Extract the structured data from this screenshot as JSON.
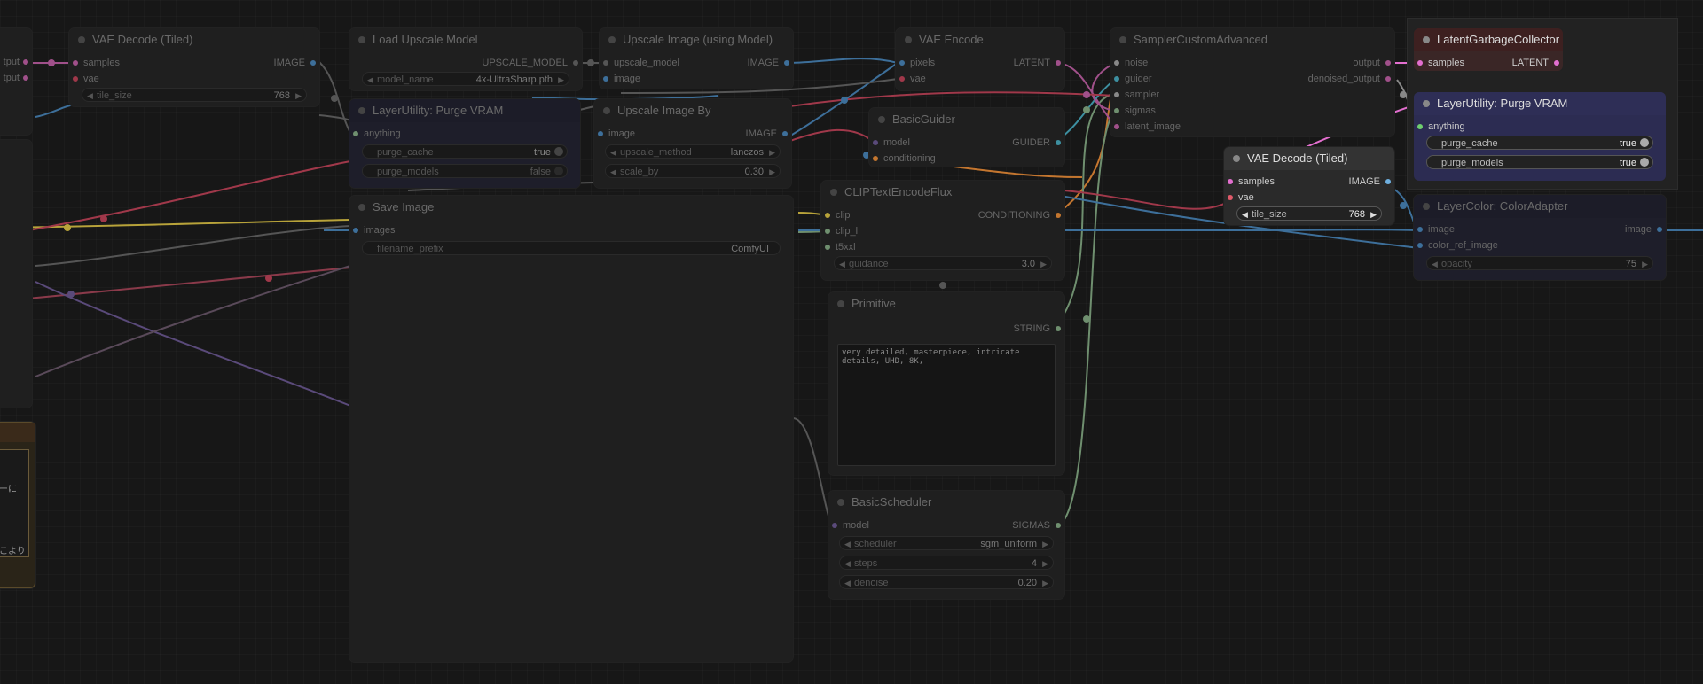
{
  "nodes": {
    "vae_decode_tiled_left": {
      "title": "VAE Decode (Tiled)",
      "inputs": [
        "samples",
        "vae"
      ],
      "output": "IMAGE",
      "tile_size": {
        "label": "tile_size",
        "value": "768"
      }
    },
    "left_cut": {
      "outputs": [
        "tput",
        "tput"
      ],
      "text_fragments": [
        "ーに",
        "こより"
      ]
    },
    "load_upscale_model": {
      "title": "Load Upscale Model",
      "output": "UPSCALE_MODEL",
      "model_name": {
        "label": "model_name",
        "value": "4x-UltraSharp.pth"
      }
    },
    "upscale_image_using_model": {
      "title": "Upscale Image (using Model)",
      "inputs": [
        "upscale_model",
        "image"
      ],
      "output": "IMAGE"
    },
    "purge_vram_left": {
      "title": "LayerUtility: Purge VRAM",
      "input": "anything",
      "purge_cache": {
        "label": "purge_cache",
        "value": "true"
      },
      "purge_models": {
        "label": "purge_models",
        "value": "false"
      }
    },
    "upscale_image_by": {
      "title": "Upscale Image By",
      "input": "image",
      "output": "IMAGE",
      "upscale_method": {
        "label": "upscale_method",
        "value": "lanczos"
      },
      "scale_by": {
        "label": "scale_by",
        "value": "0.30"
      }
    },
    "save_image": {
      "title": "Save Image",
      "input": "images",
      "filename_prefix": {
        "label": "filename_prefix",
        "value": "ComfyUI"
      }
    },
    "vae_encode": {
      "title": "VAE Encode",
      "inputs": [
        "pixels",
        "vae"
      ],
      "output": "LATENT"
    },
    "basic_guider": {
      "title": "BasicGuider",
      "inputs": [
        "model",
        "conditioning"
      ],
      "output": "GUIDER"
    },
    "clip_text_encode_flux": {
      "title": "CLIPTextEncodeFlux",
      "inputs": [
        "clip",
        "clip_l",
        "t5xxl"
      ],
      "output": "CONDITIONING",
      "guidance": {
        "label": "guidance",
        "value": "3.0"
      }
    },
    "primitive": {
      "title": "Primitive",
      "output": "STRING",
      "text": "very detailed, masterpiece, intricate details, UHD, 8K,"
    },
    "basic_scheduler": {
      "title": "BasicScheduler",
      "input": "model",
      "output": "SIGMAS",
      "scheduler": {
        "label": "scheduler",
        "value": "sgm_uniform"
      },
      "steps": {
        "label": "steps",
        "value": "4"
      },
      "denoise": {
        "label": "denoise",
        "value": "0.20"
      }
    },
    "sampler_custom_advanced": {
      "title": "SamplerCustomAdvanced",
      "inputs": [
        "noise",
        "guider",
        "sampler",
        "sigmas",
        "latent_image"
      ],
      "outputs": [
        "output",
        "denoised_output"
      ]
    },
    "latent_garbage_collector": {
      "title": "LatentGarbageCollector",
      "input": "samples",
      "output": "LATENT"
    },
    "purge_vram_right": {
      "title": "LayerUtility: Purge VRAM",
      "input": "anything",
      "purge_cache": {
        "label": "purge_cache",
        "value": "true"
      },
      "purge_models": {
        "label": "purge_models",
        "value": "true"
      }
    },
    "vae_decode_tiled_right": {
      "title": "VAE Decode (Tiled)",
      "inputs": [
        "samples",
        "vae"
      ],
      "output": "IMAGE",
      "tile_size": {
        "label": "tile_size",
        "value": "768"
      }
    },
    "layer_color_adapter": {
      "title": "LayerColor: ColorAdapter",
      "inputs": [
        "image",
        "color_ref_image"
      ],
      "output": "image",
      "opacity": {
        "label": "opacity",
        "value": "75"
      }
    }
  },
  "colors": {
    "background": "#171717",
    "image_wire": "#3d6f9a",
    "vae_wire": "#a0384a",
    "latent_wire": "#e36fcf",
    "clip_wire": "#b8a33a",
    "model_wire": "#6a5a8a",
    "sigmas_wire": "#6f8f6f",
    "selected_purge_header": "#3c3c6a",
    "latent_gc_header": "#5a2a2a"
  },
  "icons": [
    "arrow-left-icon",
    "arrow-right-icon",
    "toggle-icon",
    "node-collapse-dot-icon"
  ]
}
